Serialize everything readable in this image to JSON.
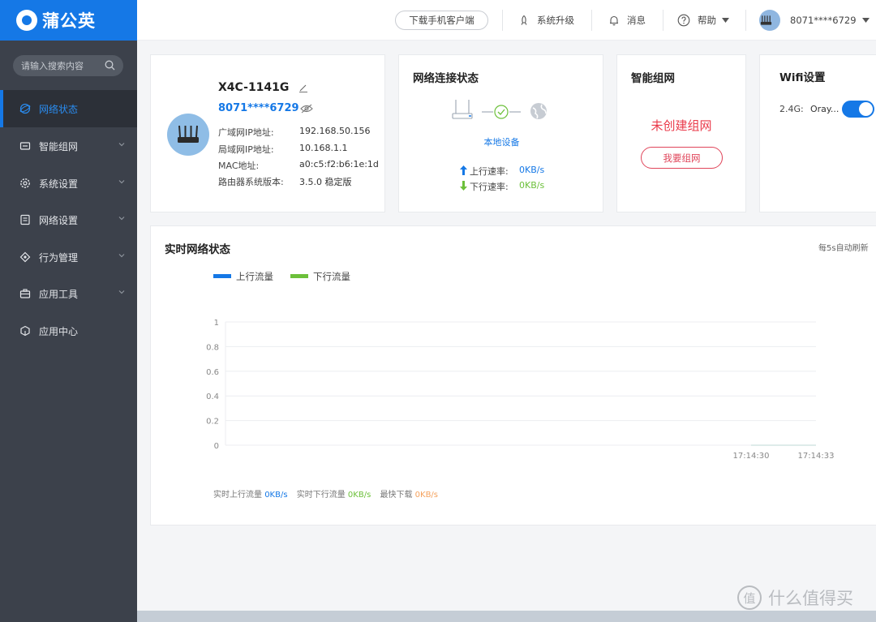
{
  "app": {
    "brand": "蒲公英",
    "accent": "#1578e6"
  },
  "sidebar": {
    "search_placeholder": "请输入搜索内容",
    "items": [
      {
        "label": "网络状态",
        "icon": "globe-icon",
        "active": true
      },
      {
        "label": "智能组网",
        "icon": "mesh-icon"
      },
      {
        "label": "系统设置",
        "icon": "gear-icon"
      },
      {
        "label": "网络设置",
        "icon": "network-settings-icon"
      },
      {
        "label": "行为管理",
        "icon": "behavior-icon"
      },
      {
        "label": "应用工具",
        "icon": "toolbox-icon"
      },
      {
        "label": "应用中心",
        "icon": "app-center-icon"
      }
    ]
  },
  "topbar": {
    "download_label": "下载手机客户端",
    "upgrade_label": "系统升级",
    "messages_label": "消息",
    "help_label": "帮助",
    "account": "8071****6729"
  },
  "device_card": {
    "name": "X4C-1141G",
    "id": "8071****6729",
    "rows": [
      {
        "label": "广域网IP地址:",
        "value": "192.168.50.156"
      },
      {
        "label": "局域网IP地址:",
        "value": "10.168.1.1"
      },
      {
        "label": "MAC地址:",
        "value": "a0:c5:f2:b6:1e:1d"
      },
      {
        "label": "路由器系统版本:",
        "value": "3.5.0 稳定版"
      }
    ]
  },
  "network_card": {
    "title": "网络连接状态",
    "local_device": "本地设备",
    "up_label": "上行速率:",
    "up_value": "0KB/s",
    "down_label": "下行速率:",
    "down_value": "0KB/s"
  },
  "mesh_card": {
    "title": "智能组网",
    "status": "未创建组网",
    "button": "我要组网"
  },
  "wifi_card": {
    "title": "Wifi设置",
    "band": "2.4G:",
    "ssid": "Oray...",
    "enabled": true
  },
  "traffic": {
    "title": "实时网络状态",
    "refresh_note": "每5s自动刷新",
    "legend_up": "上行流量",
    "legend_down": "下行流量",
    "stat_up_label": "实时上行流量",
    "stat_up_value": "0KB/s",
    "stat_down_label": "实时下行流量",
    "stat_down_value": "0KB/s",
    "stat_max_label": "最快下载",
    "stat_max_value": "0KB/s"
  },
  "chart_data": {
    "type": "line",
    "x": [
      "17:14:30",
      "17:14:33"
    ],
    "series": [
      {
        "name": "上行流量",
        "values": [
          0,
          0
        ],
        "color": "#1578e6"
      },
      {
        "name": "下行流量",
        "values": [
          0,
          0
        ],
        "color": "#6cc03a"
      }
    ],
    "yticks": [
      "1",
      "0.8",
      "0.6",
      "0.4",
      "0.2",
      "0"
    ],
    "ylim": [
      0,
      1
    ],
    "grid": true,
    "legend": "top-left"
  },
  "watermark": "什么值得买"
}
